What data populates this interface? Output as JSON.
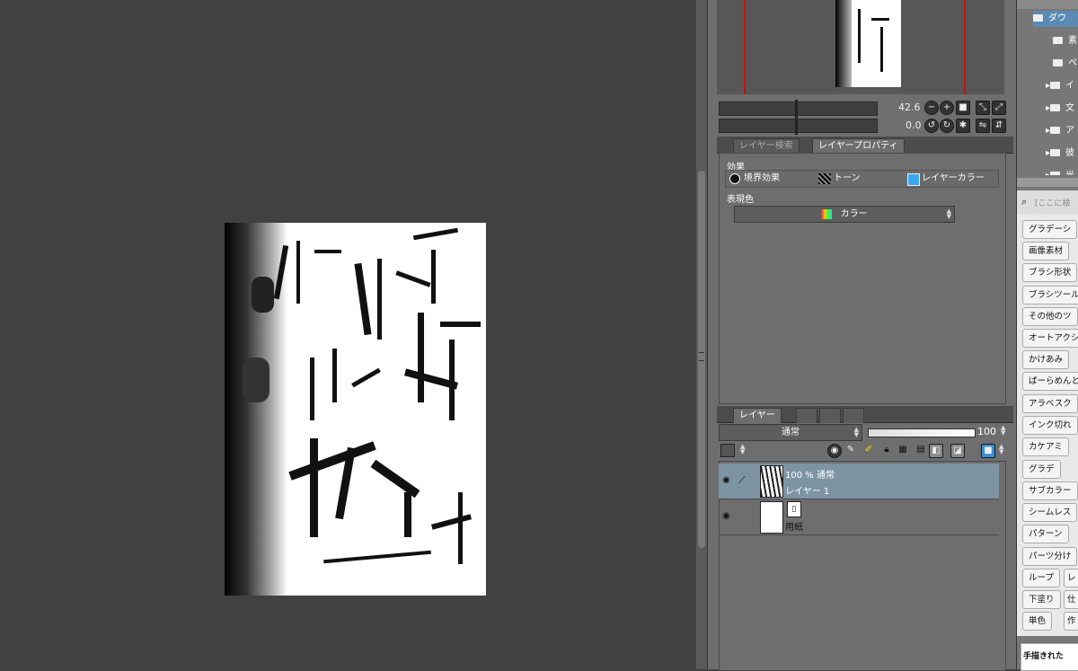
{
  "navigator": {
    "zoom": "42.6",
    "rotation": "0.0"
  },
  "tabs_props": {
    "search_tab": "レイヤー検索",
    "property_tab": "レイヤープロパティ"
  },
  "props": {
    "effect_label": "効果",
    "border_effect": "境界効果",
    "tone": "トーン",
    "layer_color": "レイヤーカラー",
    "expression_label": "表現色",
    "expression_value": "カラー"
  },
  "layers": {
    "tab_label": "レイヤー",
    "blend_mode": "通常",
    "opacity": "100",
    "items": [
      {
        "info": "100 % 通常",
        "name": "レイヤー 1"
      },
      {
        "info": "",
        "name": "用紙"
      }
    ]
  },
  "materials": {
    "folders": [
      "ダウ",
      "素",
      "ペ",
      "イ",
      "文",
      "ア",
      "彼",
      "光"
    ],
    "search_placeholder": "[ここに検",
    "tags": [
      "グラデーシ",
      "画像素材",
      "ブラシ形状",
      "ブラシツール",
      "その他のツ",
      "オートアクシ",
      "かけあみ",
      "ぱーらめんと",
      "アラベスク",
      "インク切れ",
      "カケアミ",
      "グラデ",
      "サブカラー",
      "シームレス",
      "パターン",
      "パーツ分け",
      "ループ",
      "レ",
      "下塗り",
      "仕",
      "単色",
      "作"
    ],
    "bottom_label": "手描きれた"
  },
  "colors": {
    "selected_layer": "#7d95a3",
    "panel_bg": "#6e6e6e",
    "canvas_bg": "#414141",
    "nav_line": "#c01515"
  },
  "icons": [
    "zoom-out-icon",
    "zoom-in-icon",
    "fit-icon",
    "rotate-left-icon",
    "rotate-right-icon",
    "flip-icon",
    "eye-icon",
    "pen-icon",
    "lock-icon",
    "folder-icon",
    "search-icon"
  ]
}
